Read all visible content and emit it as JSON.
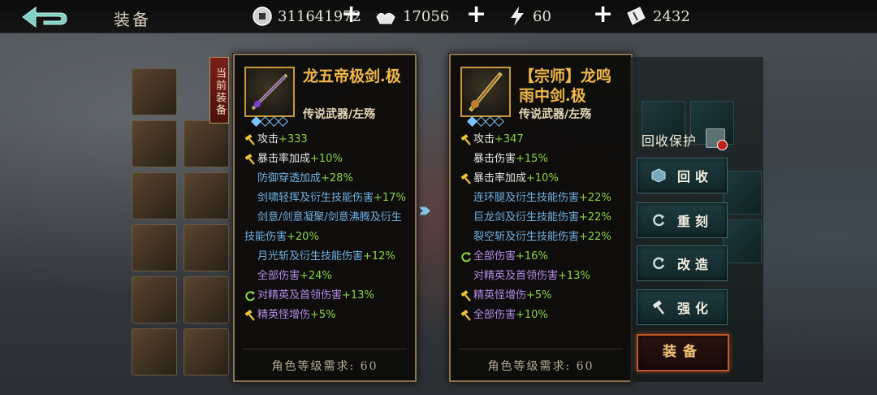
{
  "header": {
    "title": "装备",
    "resources": [
      {
        "icon": "silver-coin-icon",
        "value": "311641972"
      },
      {
        "icon": "ingot-icon",
        "value": "17056"
      },
      {
        "icon": "energy-icon",
        "value": "60"
      },
      {
        "icon": "ticket-icon",
        "value": "2432"
      }
    ],
    "plus_label": "+"
  },
  "current_tag": "当前装备",
  "current_item": {
    "name": "龙五帝极剑.极",
    "type": "传说武器/左殇",
    "stats": [
      {
        "icon": "hammer-icon",
        "label": "攻击",
        "value": "+333",
        "color": "white"
      },
      {
        "icon": "hammer-icon",
        "label": "暴击率加成",
        "value": "+10%",
        "color": "white"
      },
      {
        "icon": "",
        "label": "防御穿透加成",
        "value": "+28%",
        "color": "blue"
      },
      {
        "icon": "",
        "label": "剑啸轻挥及衍生技能伤害",
        "value": "+17%",
        "color": "blue"
      },
      {
        "icon": "",
        "label": "剑意/剑意凝聚/剑意沸腾及衍生技能伤害",
        "value": "+20%",
        "color": "blue",
        "wrap": true
      },
      {
        "icon": "",
        "label": "月光斩及衍生技能伤害",
        "value": "+12%",
        "color": "blue"
      },
      {
        "icon": "",
        "label": "全部伤害",
        "value": "+24%",
        "color": "purple"
      },
      {
        "icon": "refresh-icon",
        "label": "对精英及首领伤害",
        "value": "+13%",
        "color": "purple"
      },
      {
        "icon": "hammer-icon",
        "label": "精英怪增伤",
        "value": "+5%",
        "color": "purple"
      }
    ],
    "requirement": "角色等级需求: 60"
  },
  "compare_item": {
    "name": "【宗师】龙鸣雨中剑.极",
    "type": "传说武器/左殇",
    "stats": [
      {
        "icon": "hammer-icon",
        "label": "攻击",
        "value": "+347",
        "color": "white"
      },
      {
        "icon": "",
        "label": "暴击伤害",
        "value": "+15%",
        "color": "white"
      },
      {
        "icon": "hammer-icon",
        "label": "暴击率加成",
        "value": "+10%",
        "color": "white"
      },
      {
        "icon": "",
        "label": "连环腿及衍生技能伤害",
        "value": "+22%",
        "color": "blue"
      },
      {
        "icon": "",
        "label": "巨龙剑及衍生技能伤害",
        "value": "+22%",
        "color": "blue"
      },
      {
        "icon": "",
        "label": "裂空斩及衍生技能伤害",
        "value": "+22%",
        "color": "blue"
      },
      {
        "icon": "refresh-icon",
        "label": "全部伤害",
        "value": "+16%",
        "color": "purple"
      },
      {
        "icon": "",
        "label": "对精英及首领伤害",
        "value": "+13%",
        "color": "purple"
      },
      {
        "icon": "hammer-icon",
        "label": "精英怪增伤",
        "value": "+5%",
        "color": "purple"
      },
      {
        "icon": "hammer-icon",
        "label": "全部伤害",
        "value": "+10%",
        "color": "purple"
      }
    ],
    "requirement": "角色等级需求: 60"
  },
  "actions": {
    "protect_label": "回收保护",
    "recycle": "回收",
    "reforge": "重刻",
    "modify": "改造",
    "enhance": "强化",
    "equip": "装备"
  },
  "colors": {
    "stat_white": "#e8e8e8",
    "stat_blue": "#6fb2e6",
    "stat_purple": "#b48ae8",
    "value_green": "#8ad24a",
    "name_gold": "#f2b84a"
  }
}
